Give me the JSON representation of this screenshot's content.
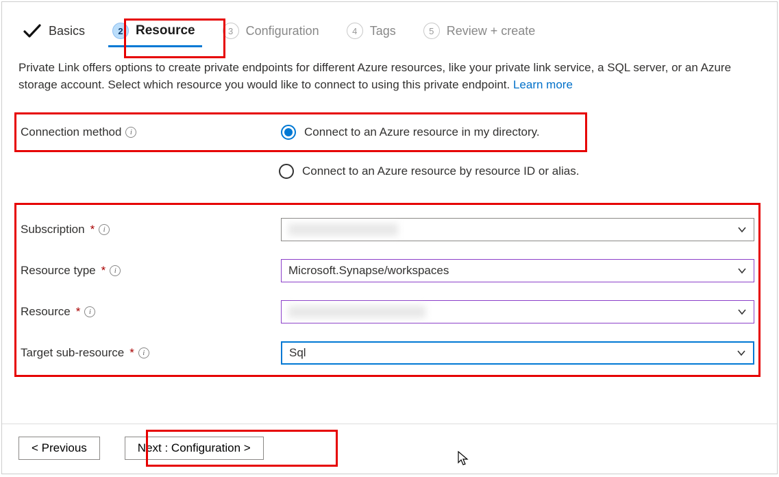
{
  "tabs": {
    "basics": {
      "label": "Basics"
    },
    "resource": {
      "number": "2",
      "label": "Resource"
    },
    "configuration": {
      "number": "3",
      "label": "Configuration"
    },
    "tags": {
      "number": "4",
      "label": "Tags"
    },
    "review": {
      "number": "5",
      "label": "Review + create"
    }
  },
  "description": {
    "text": "Private Link offers options to create private endpoints for different Azure resources, like your private link service, a SQL server, or an Azure storage account. Select which resource you would like to connect to using this private endpoint.  ",
    "link": "Learn more"
  },
  "connection_method": {
    "label": "Connection method",
    "options": {
      "directory": "Connect to an Azure resource in my directory.",
      "resource_id": "Connect to an Azure resource by resource ID or alias."
    }
  },
  "fields": {
    "subscription": {
      "label": "Subscription",
      "value": ""
    },
    "resource_type": {
      "label": "Resource type",
      "value": "Microsoft.Synapse/workspaces"
    },
    "resource": {
      "label": "Resource",
      "value": ""
    },
    "target_sub_resource": {
      "label": "Target sub-resource",
      "value": "Sql"
    }
  },
  "footer": {
    "previous": "< Previous",
    "next": "Next : Configuration >"
  }
}
